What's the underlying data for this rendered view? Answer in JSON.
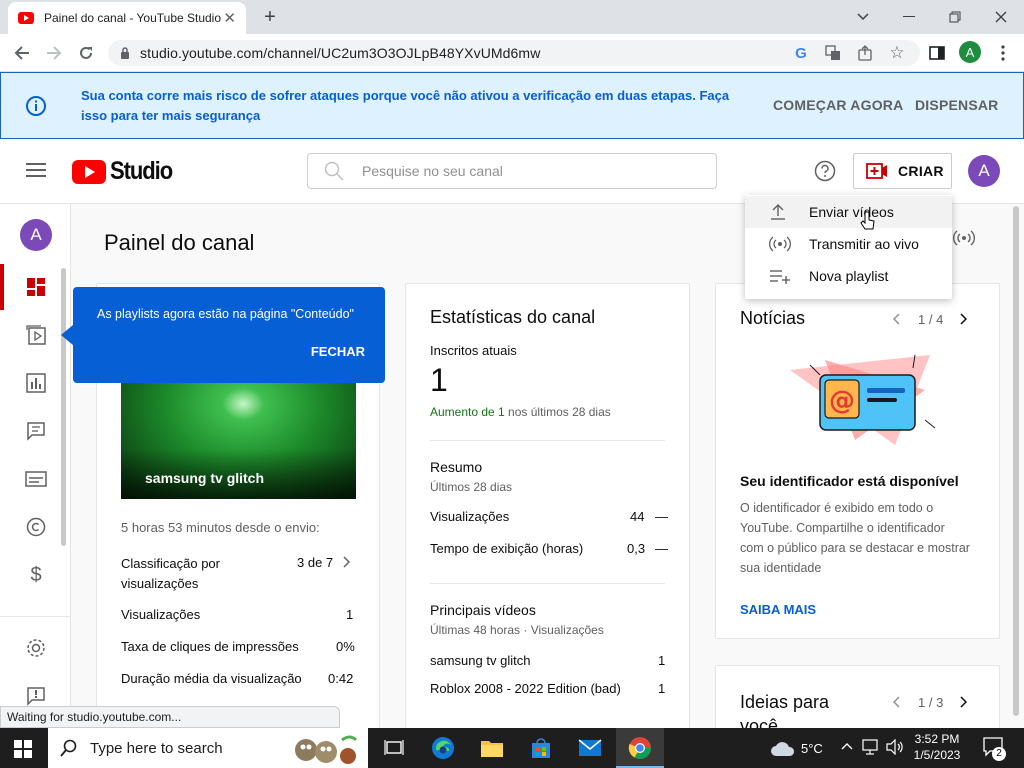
{
  "browser": {
    "tab_title": "Painel do canal - YouTube Studio",
    "url": "studio.youtube.com/channel/UC2um3O3OJLpB48YXvUMd6mw",
    "profile_initial": "A",
    "status_text": "Waiting for studio.youtube.com..."
  },
  "banner": {
    "message": "Sua conta corre mais risco de sofrer ataques porque você não ativou a verificação em duas etapas. Faça isso para ter mais segurança",
    "start_label": "COMEÇAR AGORA",
    "dismiss_label": "DISPENSAR"
  },
  "header": {
    "logo_text": "Studio",
    "search_placeholder": "Pesquise no seu canal",
    "create_label": "CRIAR",
    "avatar_initial": "A"
  },
  "sidebar": {
    "avatar_initial": "A"
  },
  "create_menu": {
    "items": [
      "Enviar vídeos",
      "Transmitir ao vivo",
      "Nova playlist"
    ]
  },
  "page": {
    "title": "Painel do canal"
  },
  "tooltip": {
    "text": "As playlists agora estão na página \"Conteúdo\"",
    "close_label": "FECHAR"
  },
  "latest_video": {
    "thumb_title": "samsung tv glitch",
    "since_upload": "5 horas 53 minutos desde o envio:",
    "rows": [
      {
        "label": "Classificação por visualizações",
        "value": "3 de 7"
      },
      {
        "label": "Visualizações",
        "value": "1"
      },
      {
        "label": "Taxa de cliques de impressões",
        "value": "0%"
      },
      {
        "label": "Duração média da visualização",
        "value": "0:42"
      }
    ]
  },
  "stats": {
    "title": "Estatísticas do canal",
    "subs_label": "Inscritos atuais",
    "subs_value": "1",
    "growth_prefix": "Aumento de 1",
    "growth_suffix": " nos últimos 28 dias",
    "summary_title": "Resumo",
    "summary_period": "Últimos 28 dias",
    "summary_rows": [
      {
        "label": "Visualizações",
        "value": "44",
        "trend": "—"
      },
      {
        "label": "Tempo de exibição (horas)",
        "value": "0,3",
        "trend": "—"
      }
    ],
    "top_title": "Principais vídeos",
    "top_period": "Últimas 48 horas · Visualizações",
    "top_rows": [
      {
        "label": "samsung tv glitch",
        "value": "1"
      },
      {
        "label": "Roblox 2008 - 2022 Edition (bad)",
        "value": "1"
      }
    ]
  },
  "news": {
    "title": "Notícias",
    "pager": "1 / 4",
    "headline": "Seu identificador está disponível",
    "body": "O identificador é exibido em todo o YouTube. Compartilhe o identificador com o público para se destacar e mostrar sua identidade",
    "link": "SAIBA MAIS"
  },
  "ideas": {
    "title": "Ideias para você",
    "pager": "1 / 3"
  },
  "taskbar": {
    "search_placeholder": "Type here to search",
    "temperature": "5°C",
    "time": "3:52 PM",
    "date": "1/5/2023",
    "notification_count": "2"
  },
  "colors": {
    "brand_red": "#ff0000",
    "link_blue": "#065fd4",
    "banner_bg": "#def1ff",
    "growth_green": "#107516",
    "avatar_purple": "#7b49b8"
  }
}
